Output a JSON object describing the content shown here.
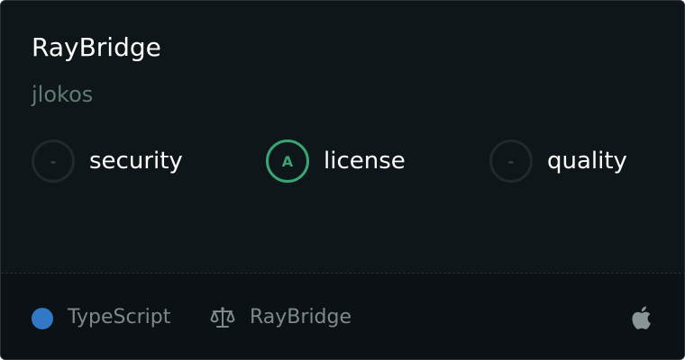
{
  "repo": {
    "name": "RayBridge",
    "owner": "jlokos"
  },
  "scores": [
    {
      "grade": "-",
      "label": "security",
      "graded": false
    },
    {
      "grade": "A",
      "label": "license",
      "graded": true
    },
    {
      "grade": "-",
      "label": "quality",
      "graded": false
    }
  ],
  "footer": {
    "language": "TypeScript",
    "language_color": "#3178c6",
    "license": "RayBridge",
    "license_icon": "scale-icon",
    "platform_icon": "apple-icon"
  },
  "colors": {
    "background": "#0f1619",
    "footer_background": "#0b1114",
    "grade_accent": "#3aa574",
    "owner_text": "#5f7b72"
  }
}
